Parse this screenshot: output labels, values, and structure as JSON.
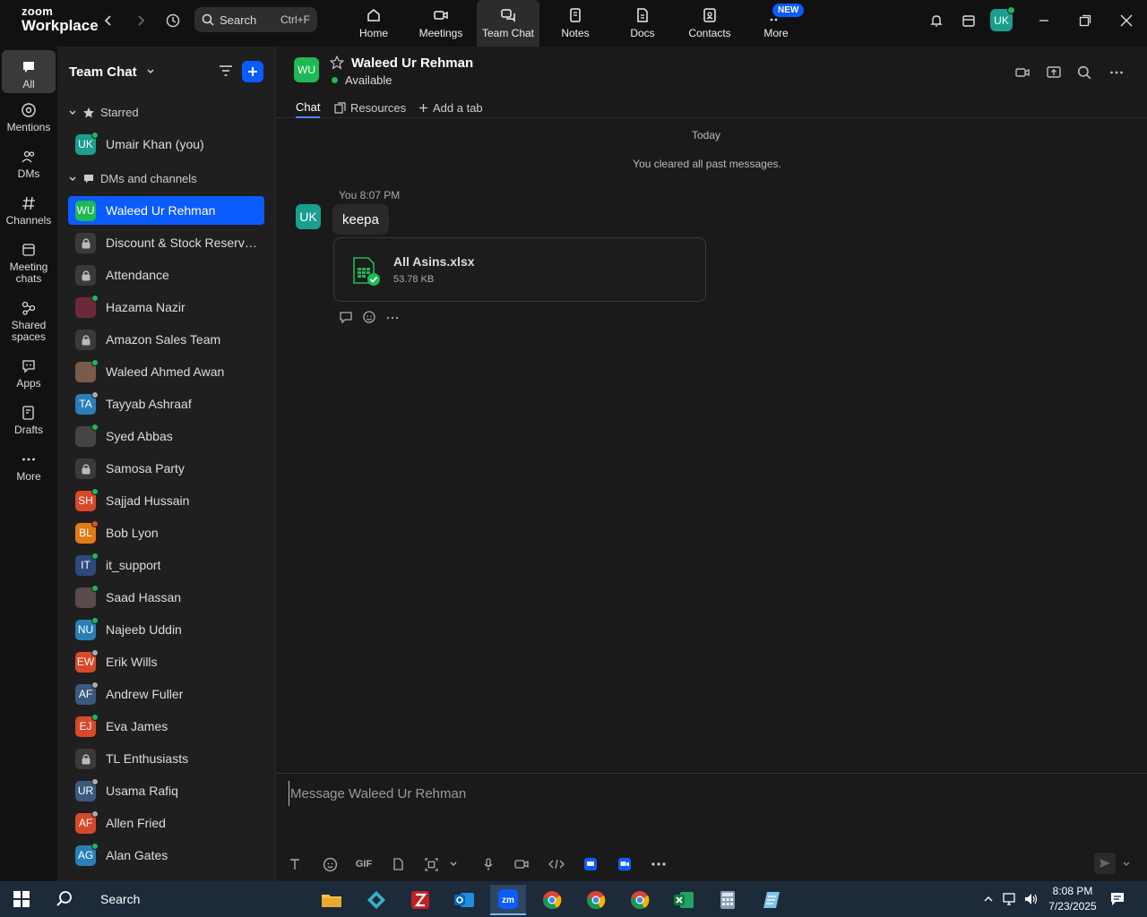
{
  "app": {
    "logo_line1": "zoom",
    "logo_line2": "Workplace"
  },
  "topbar": {
    "search_label": "Search",
    "search_shortcut": "Ctrl+F",
    "nav": [
      {
        "label": "Home",
        "icon": "home-icon"
      },
      {
        "label": "Meetings",
        "icon": "video-icon"
      },
      {
        "label": "Team Chat",
        "icon": "chat-icon"
      },
      {
        "label": "Notes",
        "icon": "notes-icon"
      },
      {
        "label": "Docs",
        "icon": "docs-icon"
      },
      {
        "label": "Contacts",
        "icon": "contacts-icon"
      },
      {
        "label": "More",
        "icon": "more-icon"
      }
    ],
    "new_badge": "NEW",
    "user_initials": "UK"
  },
  "rail": {
    "items": [
      {
        "label": "All"
      },
      {
        "label": "Mentions"
      },
      {
        "label": "DMs"
      },
      {
        "label": "Channels"
      },
      {
        "label": "Meeting chats"
      },
      {
        "label": "Shared spaces"
      },
      {
        "label": "Apps"
      },
      {
        "label": "Drafts"
      },
      {
        "label": "More"
      }
    ]
  },
  "list": {
    "title": "Team Chat",
    "starred_label": "Starred",
    "dms_label": "DMs and channels",
    "starred": [
      {
        "name": "Umair Khan (you)",
        "initials": "UK",
        "color": "#1a9e8f",
        "status": "#1db954"
      }
    ],
    "items": [
      {
        "name": "Waleed Ur Rehman",
        "initials": "WU",
        "color": "#1db954",
        "status": "",
        "active": true
      },
      {
        "name": "Discount & Stock Reservati...",
        "initials": "",
        "color": "#3a3a3a",
        "status": "",
        "lock": true
      },
      {
        "name": "Attendance",
        "initials": "",
        "color": "#3a3a3a",
        "status": "",
        "lock": true
      },
      {
        "name": "Hazama Nazir",
        "initials": "",
        "color": "#6b2a3a",
        "status": "#1db954"
      },
      {
        "name": "Amazon Sales Team",
        "initials": "",
        "color": "#3a3a3a",
        "status": "",
        "lock": true
      },
      {
        "name": "Waleed Ahmed Awan",
        "initials": "",
        "color": "#7a5a4a",
        "status": "#1db954"
      },
      {
        "name": "Tayyab Ashraaf",
        "initials": "TA",
        "color": "#2a7fb8",
        "status": "#aaaaaa"
      },
      {
        "name": "Syed Abbas",
        "initials": "",
        "color": "#444444",
        "status": "#1db954"
      },
      {
        "name": "Samosa Party",
        "initials": "",
        "color": "#3a3a3a",
        "status": "",
        "lock": true
      },
      {
        "name": "Sajjad Hussain",
        "initials": "SH",
        "color": "#d9482b",
        "status": "#1db954"
      },
      {
        "name": "Bob Lyon",
        "initials": "BL",
        "color": "#e07b16",
        "status": "#e0502b"
      },
      {
        "name": "it_support",
        "initials": "IT",
        "color": "#2c4a7a",
        "status": "#1db954"
      },
      {
        "name": "Saad Hassan",
        "initials": "",
        "color": "#5a4a4a",
        "status": "#1db954"
      },
      {
        "name": "Najeeb Uddin",
        "initials": "NU",
        "color": "#2a7fb8",
        "status": "#1db954"
      },
      {
        "name": "Erik Wills",
        "initials": "EW",
        "color": "#d9482b",
        "status": "#aaaaaa"
      },
      {
        "name": "Andrew Fuller",
        "initials": "AF",
        "color": "#3a5a80",
        "status": "#aaaaaa"
      },
      {
        "name": "Eva James",
        "initials": "EJ",
        "color": "#d9482b",
        "status": "#1db954"
      },
      {
        "name": "TL Enthusiasts",
        "initials": "",
        "color": "#3a3a3a",
        "status": "",
        "lock": true
      },
      {
        "name": "Usama Rafiq",
        "initials": "UR",
        "color": "#3a5a80",
        "status": "#aaaaaa"
      },
      {
        "name": "Allen Fried",
        "initials": "AF",
        "color": "#d9482b",
        "status": "#aaaaaa"
      },
      {
        "name": "Alan Gates",
        "initials": "AG",
        "color": "#2a7fb8",
        "status": "#1db954"
      }
    ]
  },
  "conversation": {
    "name": "Waleed Ur Rehman",
    "initials": "WU",
    "status": "Available",
    "tabs": [
      {
        "label": "Chat"
      },
      {
        "label": "Resources"
      },
      {
        "label": "Add a tab"
      }
    ],
    "day_label": "Today",
    "cleared_notice": "You cleared all past messages.",
    "message": {
      "sender_initials": "UK",
      "meta": "You 8:07 PM",
      "text": "keepa",
      "file_name": "All Asins.xlsx",
      "file_size": "53.78 KB"
    },
    "composer_placeholder": "Message Waleed Ur Rehman",
    "gif_label": "GIF"
  },
  "taskbar": {
    "search_label": "Search",
    "time": "8:08 PM",
    "date": "7/23/2025"
  }
}
